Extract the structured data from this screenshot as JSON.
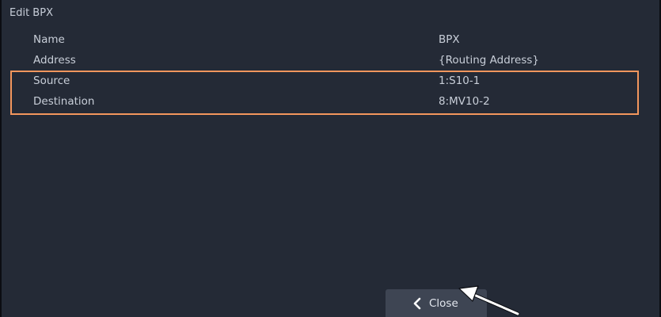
{
  "window": {
    "title": "Edit BPX"
  },
  "fields": [
    {
      "label": "Name",
      "value": "BPX"
    },
    {
      "label": "Address",
      "value": "{Routing Address}"
    },
    {
      "label": "Source",
      "value": "1:S10-1"
    },
    {
      "label": "Destination",
      "value": "8:MV10-2"
    }
  ],
  "footer": {
    "close_label": "Close",
    "close_icon": "chevron-left-icon"
  },
  "annotation": {
    "highlight_color": "#f3965d",
    "pointer_icon": "arrow-pointer-icon"
  },
  "colors": {
    "panel_background": "#242a36",
    "button_background": "#3e4553",
    "text": "#c8ced8"
  }
}
